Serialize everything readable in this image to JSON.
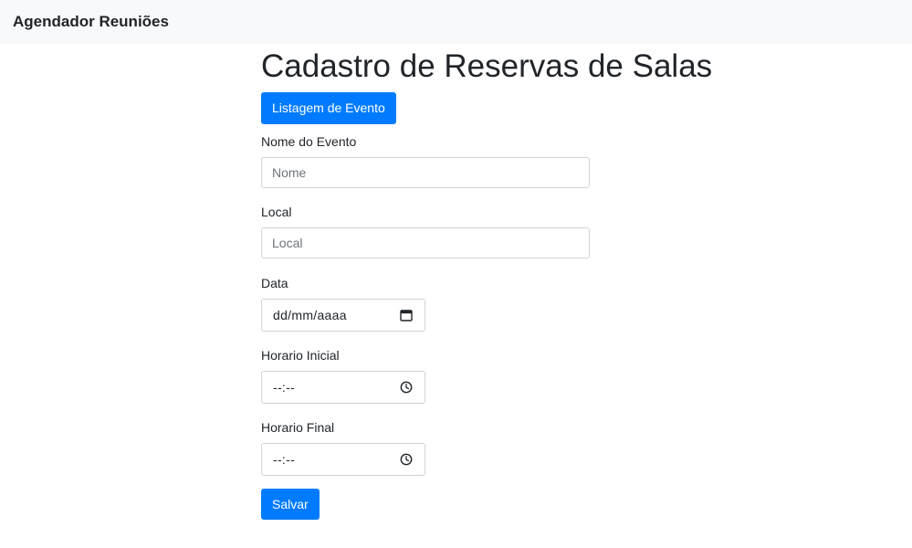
{
  "navbar": {
    "brand": "Agendador Reuniões"
  },
  "page": {
    "title": "Cadastro de Reservas de Salas",
    "list_button_label": "Listagem de Evento"
  },
  "form": {
    "event_name": {
      "label": "Nome do Evento",
      "placeholder": "Nome",
      "value": ""
    },
    "location": {
      "label": "Local",
      "placeholder": "Local",
      "value": ""
    },
    "date": {
      "label": "Data",
      "display": "dd/mm/aaaa",
      "icon": "calendar-icon"
    },
    "start_time": {
      "label": "Horario Inicial",
      "display": "--:--",
      "icon": "clock-icon"
    },
    "end_time": {
      "label": "Horario Final",
      "display": "--:--",
      "icon": "clock-icon"
    },
    "save_label": "Salvar"
  },
  "colors": {
    "primary": "#007bff",
    "navbar_bg": "#f8f9fa"
  }
}
